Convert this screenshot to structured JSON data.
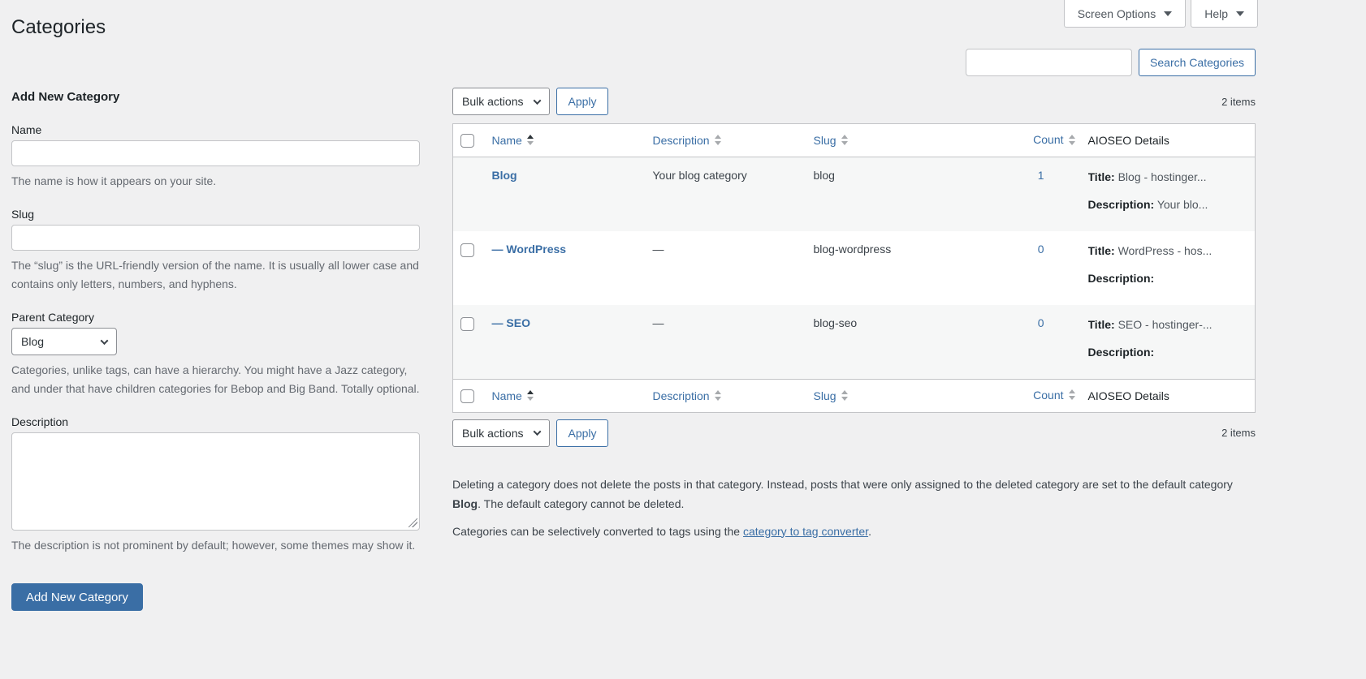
{
  "page": {
    "title": "Categories",
    "screen_options_label": "Screen Options",
    "help_label": "Help",
    "search_button_label": "Search Categories"
  },
  "form": {
    "heading": "Add New Category",
    "name_label": "Name",
    "name_help": "The name is how it appears on your site.",
    "slug_label": "Slug",
    "slug_help": "The “slug” is the URL-friendly version of the name. It is usually all lower case and contains only letters, numbers, and hyphens.",
    "parent_label": "Parent Category",
    "parent_value": "Blog",
    "parent_help": "Categories, unlike tags, can have a hierarchy. You might have a Jazz category, and under that have children categories for Bebop and Big Band. Totally optional.",
    "description_label": "Description",
    "description_help": "The description is not prominent by default; however, some themes may show it.",
    "submit_label": "Add New Category"
  },
  "list": {
    "bulk_actions_label": "Bulk actions",
    "apply_label": "Apply",
    "items_count": "2 items",
    "aioseo_title_prefix": "Title:",
    "aioseo_desc_prefix": "Description:",
    "columns": [
      {
        "label": "Name",
        "sortable": true,
        "sorted": "asc",
        "align": "left"
      },
      {
        "label": "Description",
        "sortable": true,
        "sorted": "",
        "align": "left"
      },
      {
        "label": "Slug",
        "sortable": true,
        "sorted": "",
        "align": "left"
      },
      {
        "label": "Count",
        "sortable": true,
        "sorted": "",
        "align": "right"
      },
      {
        "label": "AIOSEO Details",
        "sortable": false,
        "sorted": "",
        "align": "left"
      }
    ],
    "rows": [
      {
        "name": "Blog",
        "description": "Your blog category",
        "slug": "blog",
        "count": "1",
        "aioseo_title": "Blog - hostinger...",
        "aioseo_description": "Your blo...",
        "has_checkbox": false
      },
      {
        "name": "— WordPress",
        "description": "—",
        "slug": "blog-wordpress",
        "count": "0",
        "aioseo_title": "WordPress - hos...",
        "aioseo_description": "",
        "has_checkbox": true
      },
      {
        "name": "— SEO",
        "description": "—",
        "slug": "blog-seo",
        "count": "0",
        "aioseo_title": "SEO - hostinger-...",
        "aioseo_description": "",
        "has_checkbox": true
      }
    ]
  },
  "footer": {
    "delete_note_1": "Deleting a category does not delete the posts in that category. Instead, posts that were only assigned to the deleted category are set to the default category ",
    "delete_note_bold": "Blog",
    "delete_note_2": ". The default category cannot be deleted.",
    "convert_note_1": "Categories can be selectively converted to tags using the ",
    "convert_link_label": "category to tag converter",
    "convert_note_2": "."
  },
  "colors": {
    "accent_blue": "#3a6ea5",
    "page_background": "#f0f0f1",
    "row_stripe": "#f6f7f7",
    "border_gray": "#c3c4c7",
    "text_dark": "#1d2327",
    "text_muted": "#646970"
  }
}
